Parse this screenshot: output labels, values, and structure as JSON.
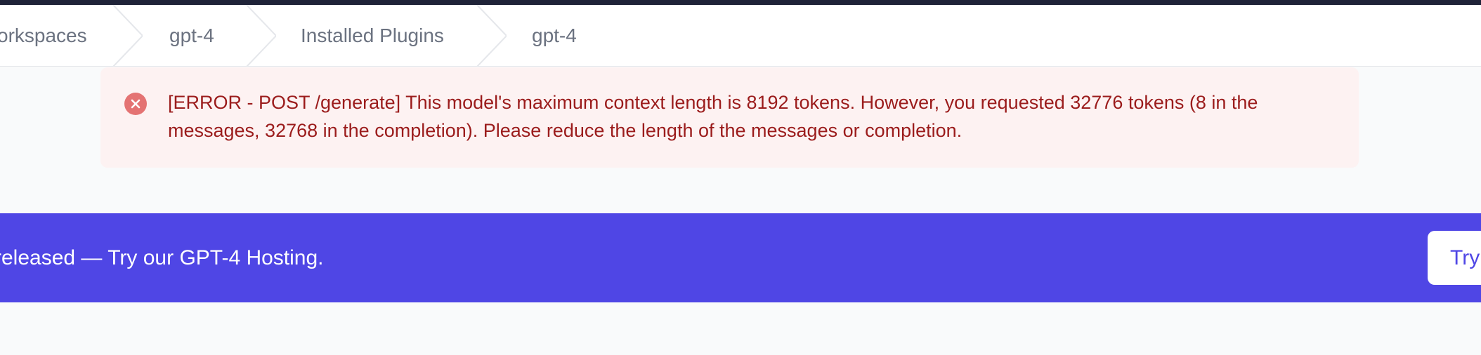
{
  "breadcrumb": {
    "items": [
      {
        "label": "orkspaces"
      },
      {
        "label": "gpt-4"
      },
      {
        "label": "Installed Plugins"
      },
      {
        "label": "gpt-4"
      }
    ]
  },
  "alert": {
    "icon": "x-circle-icon",
    "message": "[ERROR - POST /generate] This model's maximum context length is 8192 tokens. However, you requested 32776 tokens (8 in the messages, 32768 in the completion). Please reduce the length of the messages or completion.",
    "color": "#9b1c1c",
    "background": "#fdf2f2"
  },
  "banner": {
    "text": "released — Try our GPT-4 Hosting.",
    "button_label": "Try",
    "background": "#4f46e5"
  }
}
